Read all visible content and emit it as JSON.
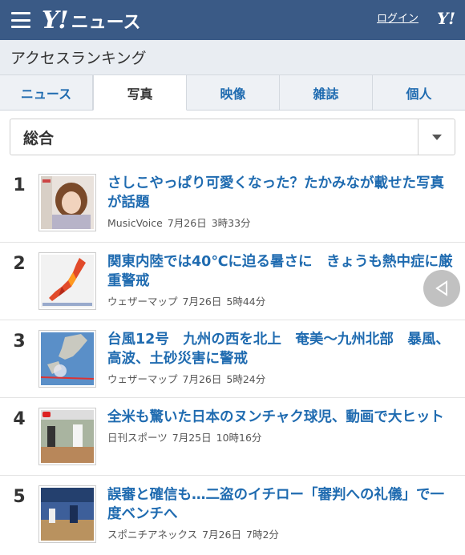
{
  "header": {
    "logo_mark": "Y!",
    "logo_text": "ニュース",
    "login_label": "ログイン",
    "mini_logo": "Y!"
  },
  "page": {
    "title": "アクセスランキング"
  },
  "tabs": [
    {
      "label": "ニュース",
      "active": false
    },
    {
      "label": "写真",
      "active": true
    },
    {
      "label": "映像",
      "active": false
    },
    {
      "label": "雑誌",
      "active": false
    },
    {
      "label": "個人",
      "active": false
    }
  ],
  "category_select": {
    "value": "総合"
  },
  "ranking": [
    {
      "rank": "1",
      "title": "さしこやっぱり可愛くなった？たかみなが載せた写真が話題",
      "source": "MusicVoice",
      "date": "7月26日",
      "time": "3時33分",
      "thumb": "portrait"
    },
    {
      "rank": "2",
      "title": "関東内陸では40℃に迫る暑さに　きょうも熱中症に厳重警戒",
      "source": "ウェザーマップ",
      "date": "7月26日",
      "time": "5時44分",
      "thumb": "heatmap"
    },
    {
      "rank": "3",
      "title": "台風12号　九州の西を北上　奄美〜九州北部　暴風、高波、土砂災害に警戒",
      "source": "ウェザーマップ",
      "date": "7月26日",
      "time": "5時24分",
      "thumb": "typhoon"
    },
    {
      "rank": "4",
      "title": "全米も驚いた日本のヌンチャク球児、動画で大ヒット",
      "source": "日刊スポーツ",
      "date": "7月25日",
      "time": "10時16分",
      "thumb": "baseball"
    },
    {
      "rank": "5",
      "title": "誤審と確信も…二盗のイチロー「審判への礼儀」で一度ベンチへ",
      "source": "スポニチアネックス",
      "date": "7月26日",
      "time": "7時2分",
      "thumb": "stadium"
    }
  ],
  "colors": {
    "header_bg": "#3a5a86",
    "link": "#1f6bb0"
  }
}
